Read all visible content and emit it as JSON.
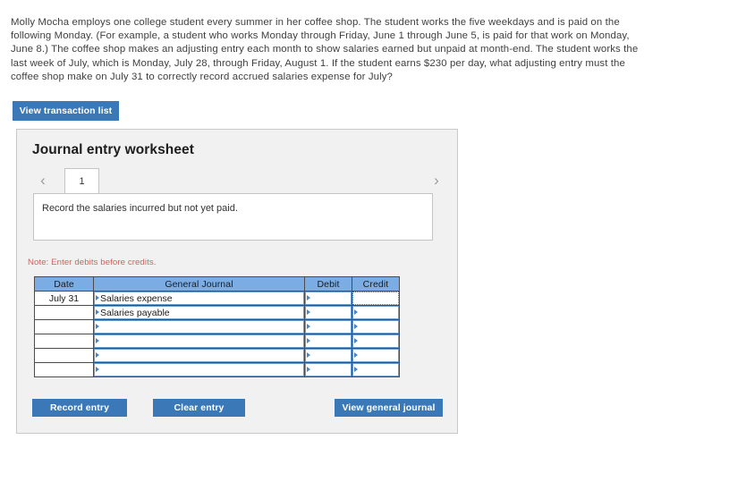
{
  "question": {
    "text": "Molly Mocha employs one college student every summer in her coffee shop. The student works the five weekdays and is paid on the following Monday. (For example, a student who works Monday through Friday, June 1 through June 5, is paid for that work on Monday, June 8.) The coffee shop makes an adjusting entry each month to show salaries earned but unpaid at month-end. The student works the last week of July, which is Monday, July 28, through Friday, August 1. If the student earns $230 per day, what adjusting entry must the coffee shop make on July 31 to correctly record accrued salaries expense for July?"
  },
  "toolbar": {
    "view_transaction_list_label": "View transaction list"
  },
  "worksheet": {
    "title": "Journal entry worksheet",
    "pager": {
      "prev_icon": "chevron-left-icon",
      "next_icon": "chevron-right-icon",
      "prev_glyph": "‹",
      "next_glyph": "›",
      "tabs": [
        {
          "label": "1",
          "active": true
        }
      ]
    },
    "instruction": "Record the salaries incurred but not yet paid.",
    "note": "Note: Enter debits before credits.",
    "table": {
      "columns": [
        "Date",
        "General Journal",
        "Debit",
        "Credit"
      ],
      "rows": [
        {
          "date": "July 31",
          "account": "Salaries expense",
          "debit": "",
          "credit": "",
          "credit_selected": true
        },
        {
          "date": "",
          "account": "Salaries payable",
          "debit": "",
          "credit": "",
          "credit_selected": false
        },
        {
          "date": "",
          "account": "",
          "debit": "",
          "credit": "",
          "credit_selected": false
        },
        {
          "date": "",
          "account": "",
          "debit": "",
          "credit": "",
          "credit_selected": false
        },
        {
          "date": "",
          "account": "",
          "debit": "",
          "credit": "",
          "credit_selected": false
        },
        {
          "date": "",
          "account": "",
          "debit": "",
          "credit": "",
          "credit_selected": false
        }
      ]
    },
    "actions": {
      "record_entry_label": "Record entry",
      "clear_entry_label": "Clear entry",
      "view_general_journal_label": "View general journal"
    }
  },
  "colors": {
    "accent_blue": "#3b78b8",
    "header_blue": "#7bade4",
    "note_red": "#c86464",
    "panel_gray": "#f1f1f1",
    "cell_border_blue": "#6f9fd0"
  }
}
